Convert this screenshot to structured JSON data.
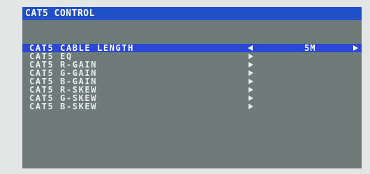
{
  "title": "CAT5 CONTROL",
  "menu": {
    "items": [
      {
        "label": "CAT5 CABLE LENGTH",
        "value": "5M"
      },
      {
        "label": "CAT5 EQ"
      },
      {
        "label": "CAT5 R-GAIN"
      },
      {
        "label": "CAT5 G-GAIN"
      },
      {
        "label": "CAT5 B-GAIN"
      },
      {
        "label": "CAT5 R-SKEW"
      },
      {
        "label": "CAT5 G-SKEW"
      },
      {
        "label": "CAT5 B-SKEW"
      }
    ]
  },
  "icons": {
    "left": "left-arrow-icon",
    "right": "right-arrow-icon"
  },
  "colors": {
    "title_bar": "#1f4fc9",
    "selection": "#2a47d6",
    "background": "#6f7a7a",
    "text": "#e8ecec"
  }
}
